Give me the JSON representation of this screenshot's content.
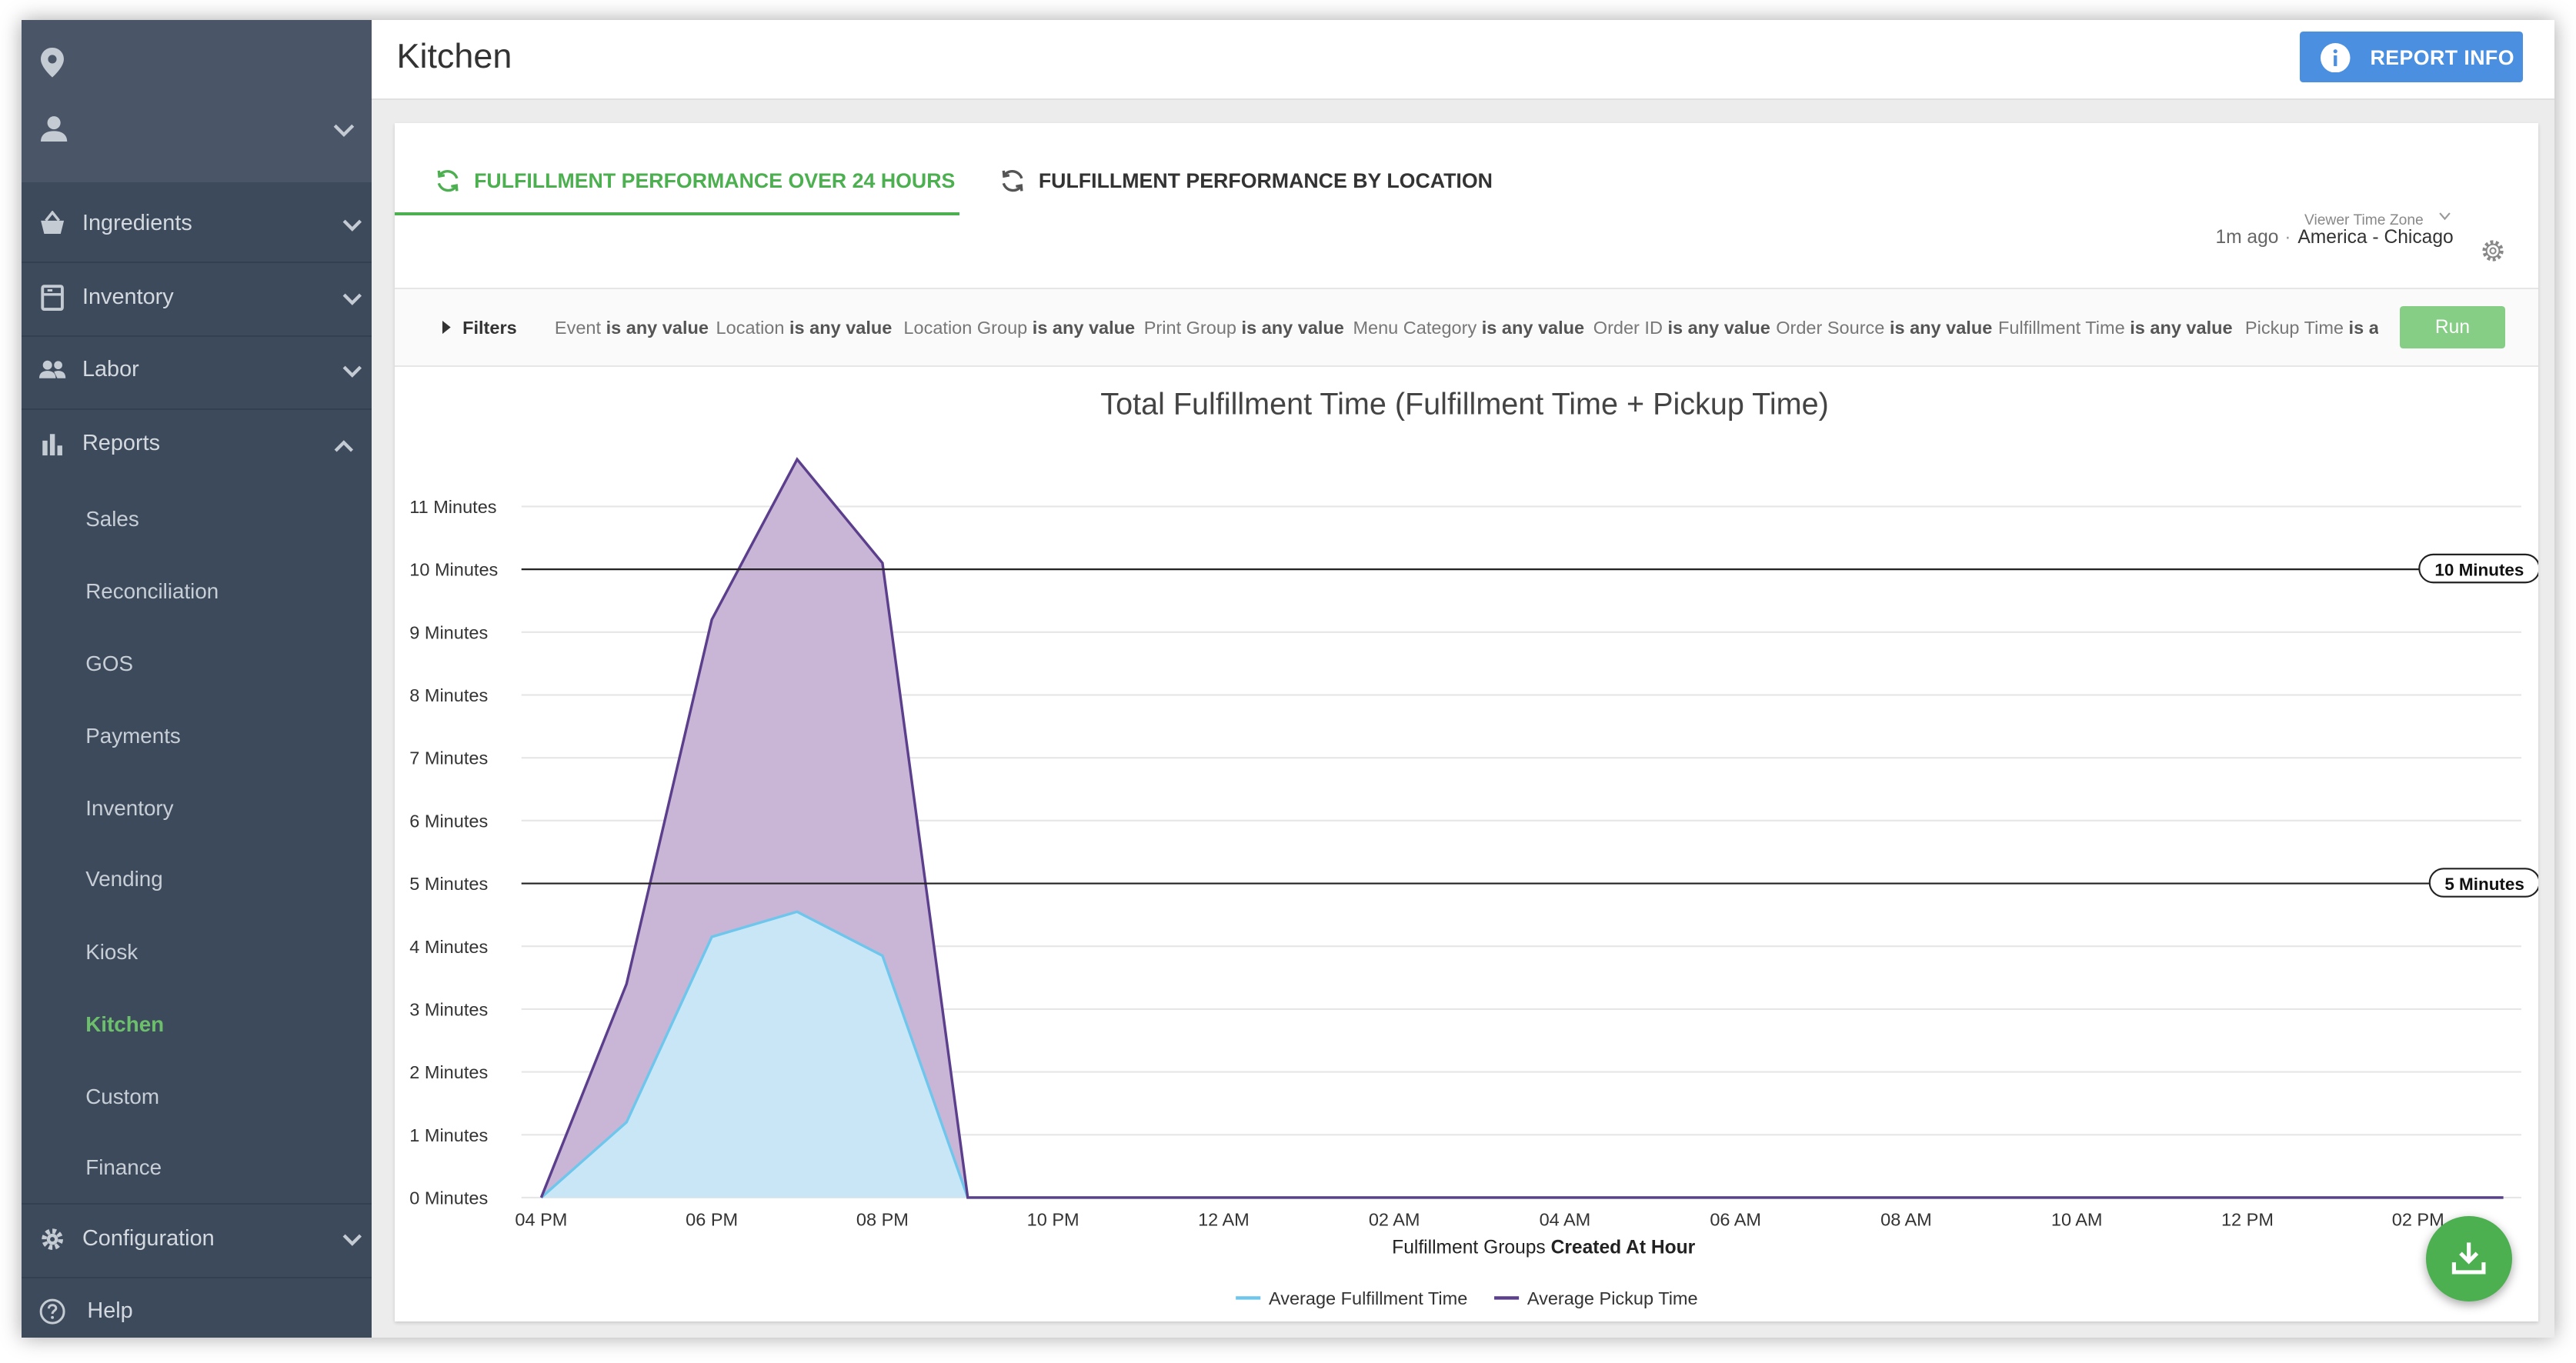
{
  "sidebar": {
    "sections": [
      {
        "label": "Ingredients",
        "icon": "basket-icon",
        "expanded": false
      },
      {
        "label": "Inventory",
        "icon": "inventory-icon",
        "expanded": false
      },
      {
        "label": "Labor",
        "icon": "people-icon",
        "expanded": false
      },
      {
        "label": "Reports",
        "icon": "bar-chart-icon",
        "expanded": true
      },
      {
        "label": "Configuration",
        "icon": "gear-icon",
        "expanded": false
      },
      {
        "label": "Help",
        "icon": "help-icon"
      }
    ],
    "report_items": [
      "Sales",
      "Reconciliation",
      "GOS",
      "Payments",
      "Inventory",
      "Vending",
      "Kiosk",
      "Kitchen",
      "Custom",
      "Finance"
    ],
    "active_item": "Kitchen"
  },
  "header": {
    "title": "Kitchen",
    "report_info_label": "REPORT INFO"
  },
  "tabs": [
    {
      "label": "FULFILLMENT PERFORMANCE OVER 24 HOURS",
      "active": true
    },
    {
      "label": "FULFILLMENT PERFORMANCE BY LOCATION",
      "active": false
    }
  ],
  "timezone": {
    "label": "Viewer Time Zone",
    "value": "America - Chicago",
    "updated": "1m ago",
    "separator": "·"
  },
  "filters": {
    "label": "Filters",
    "items": [
      {
        "field": "Event",
        "condition": "is any value"
      },
      {
        "field": "Location",
        "condition": "is any value"
      },
      {
        "field": "Location Group",
        "condition": "is any value"
      },
      {
        "field": "Print Group",
        "condition": "is any value"
      },
      {
        "field": "Menu Category",
        "condition": "is any value"
      },
      {
        "field": "Order ID",
        "condition": "is any value"
      },
      {
        "field": "Order Source",
        "condition": "is any value"
      },
      {
        "field": "Fulfillment Time",
        "condition": "is any value"
      },
      {
        "field": "Pickup Time",
        "condition": "is a"
      }
    ],
    "run_label": "Run"
  },
  "colors": {
    "accent_green": "#4caf50",
    "fulfillment_line": "#6ec6ec",
    "fulfillment_fill": "#c8e6f5",
    "pickup_line": "#5b3f8c",
    "pickup_fill": "#c9b6d6",
    "sidebar_bg": "#3d4a5c",
    "report_info_bg": "#4a8fe0"
  },
  "chart_data": {
    "type": "area",
    "title": "Total Fulfillment Time (Fulfillment Time + Pickup Time)",
    "xlabel_prefix": "Fulfillment Groups ",
    "xlabel_bold": "Created At Hour",
    "stacked": true,
    "x_ticks": [
      "04 PM",
      "06 PM",
      "08 PM",
      "10 PM",
      "12 AM",
      "02 AM",
      "04 AM",
      "06 AM",
      "08 AM",
      "10 AM",
      "12 PM",
      "02 PM"
    ],
    "y_ticks": [
      "0 Minutes",
      "1 Minutes",
      "2 Minutes",
      "3 Minutes",
      "4 Minutes",
      "5 Minutes",
      "6 Minutes",
      "7 Minutes",
      "8 Minutes",
      "9 Minutes",
      "10 Minutes",
      "11 Minutes"
    ],
    "ylim": [
      0,
      11
    ],
    "hours": [
      "04 PM",
      "05 PM",
      "06 PM",
      "07 PM",
      "08 PM",
      "09 PM",
      "10 PM",
      "11 PM",
      "12 AM",
      "01 AM",
      "02 AM",
      "03 AM",
      "04 AM",
      "05 AM",
      "06 AM",
      "07 AM",
      "08 AM",
      "09 AM",
      "10 AM",
      "11 AM",
      "12 PM",
      "01 PM",
      "02 PM",
      "03 PM"
    ],
    "series": [
      {
        "name": "Average Fulfillment Time",
        "values": [
          0,
          1.2,
          4.15,
          4.55,
          3.85,
          0,
          0,
          0,
          0,
          0,
          0,
          0,
          0,
          0,
          0,
          0,
          0,
          0,
          0,
          0,
          0,
          0,
          0,
          0
        ]
      },
      {
        "name": "Average Pickup Time",
        "values": [
          0,
          2.2,
          5.05,
          7.2,
          6.25,
          0,
          0,
          0,
          0,
          0,
          0,
          0,
          0,
          0,
          0,
          0,
          0,
          0,
          0,
          0,
          0,
          0,
          0,
          0
        ]
      }
    ],
    "reference_lines": [
      {
        "value": 10,
        "label": "10 Minutes"
      },
      {
        "value": 5,
        "label": "5 Minutes"
      }
    ],
    "grid": true,
    "legend_position": "bottom"
  }
}
